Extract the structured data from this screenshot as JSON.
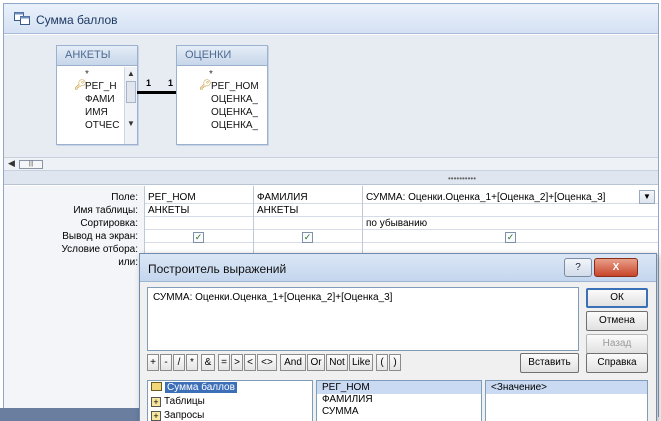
{
  "window": {
    "title": "Сумма баллов"
  },
  "tables": [
    {
      "name": "АНКЕТЫ",
      "star": "*",
      "fields": [
        "РЕГ_НОМ",
        "ФАМИЛИЯ",
        "ИМЯ",
        "ОТЧЕСТВО"
      ],
      "fields_visible": [
        "РЕГ_Н",
        "ФАМИ",
        "ИМЯ",
        "ОТЧЕС"
      ]
    },
    {
      "name": "ОЦЕНКИ",
      "star": "*",
      "fields_visible": [
        "РЕГ_НОМ",
        "ОЦЕНКА_",
        "ОЦЕНКА_",
        "ОЦЕНКА_"
      ]
    }
  ],
  "relationship": {
    "left": "1",
    "right": "1"
  },
  "grid": {
    "row_labels": [
      "Поле:",
      "Имя таблицы:",
      "Сортировка:",
      "Вывод на экран:",
      "Условие отбора:",
      "или:"
    ],
    "columns": [
      {
        "field": "РЕГ_НОМ",
        "table": "АНКЕТЫ",
        "sort": "",
        "show": true
      },
      {
        "field": "ФАМИЛИЯ",
        "table": "АНКЕТЫ",
        "sort": "",
        "show": true
      },
      {
        "field": "СУММА: Оценки.Оценка_1+[Оценка_2]+[Оценка_3]",
        "table": "",
        "sort": "по убыванию",
        "show": true
      }
    ]
  },
  "dialog": {
    "title": "Построитель выражений",
    "expression": "СУММА: Оценки.Оценка_1+[Оценка_2]+[Оценка_3]",
    "buttons": {
      "ok": "ОК",
      "cancel": "Отмена",
      "back": "Назад",
      "insert": "Вставить",
      "help": "Справка"
    },
    "operators": [
      "+",
      "-",
      "/",
      "*",
      "&",
      "=",
      ">",
      "<",
      "<>",
      "And",
      "Or",
      "Not",
      "Like",
      "(",
      ")"
    ],
    "tree": [
      "Сумма баллов",
      "Таблицы",
      "Запросы"
    ],
    "fields_list": [
      "РЕГ_НОМ",
      "ФАМИЛИЯ",
      "СУММА"
    ],
    "values_list": [
      "<Значение>"
    ],
    "titlebar": {
      "help": "?",
      "close": "X"
    }
  },
  "colors": {
    "selection": "#3d6fb8",
    "titlebar": "#c4d6ee",
    "close_button": "#c8452a"
  }
}
